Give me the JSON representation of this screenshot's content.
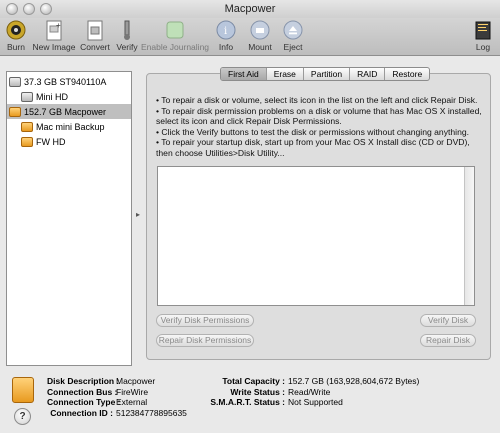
{
  "window": {
    "title": "Macpower"
  },
  "toolbar": {
    "items": [
      {
        "label": "Burn",
        "icon": "burn-icon"
      },
      {
        "label": "New Image",
        "icon": "new-image-icon"
      },
      {
        "label": "Convert",
        "icon": "convert-icon"
      },
      {
        "label": "Verify",
        "icon": "verify-icon"
      },
      {
        "label": "Enable Journaling",
        "icon": "journaling-icon"
      },
      {
        "label": "Info",
        "icon": "info-icon"
      },
      {
        "label": "Mount",
        "icon": "mount-icon"
      },
      {
        "label": "Eject",
        "icon": "eject-icon"
      },
      {
        "label": "Log",
        "icon": "log-icon"
      }
    ]
  },
  "disks": [
    {
      "label": "37.3 GB ST940110A",
      "type": "grey",
      "indent": 0,
      "selected": false
    },
    {
      "label": "Mini HD",
      "type": "grey",
      "indent": 1,
      "selected": false
    },
    {
      "label": "152.7 GB Macpower",
      "type": "orange",
      "indent": 0,
      "selected": true
    },
    {
      "label": "Mac mini Backup",
      "type": "orange",
      "indent": 1,
      "selected": false
    },
    {
      "label": "FW HD",
      "type": "orange",
      "indent": 1,
      "selected": false
    }
  ],
  "tabs": [
    "First Aid",
    "Erase",
    "Partition",
    "RAID",
    "Restore"
  ],
  "active_tab": "First Aid",
  "instructions": [
    "• To repair a disk or volume, select its icon in the list on the left and click Repair Disk.",
    "• To repair disk permission problems on a disk or volume that has Mac OS X installed, select its icon and click Repair Disk Permissions.",
    "• Click the Verify buttons to test the disk or permissions without changing anything.",
    "• To repair your startup disk, start up from your Mac OS X Install disc (CD or DVD), then choose Utilities>Disk Utility..."
  ],
  "buttons": {
    "verify_permissions": "Verify Disk Permissions",
    "repair_permissions": "Repair Disk Permissions",
    "verify_disk": "Verify Disk",
    "repair_disk": "Repair Disk"
  },
  "info": {
    "left": [
      {
        "label": "Disk Description :",
        "value": "Macpower"
      },
      {
        "label": "Connection Bus :",
        "value": "FireWire"
      },
      {
        "label": "Connection Type :",
        "value": "External"
      },
      {
        "label": "Connection ID :",
        "value": "512384778895635"
      }
    ],
    "right": [
      {
        "label": "Total Capacity :",
        "value": "152.7 GB (163,928,604,672 Bytes)"
      },
      {
        "label": "Write Status :",
        "value": "Read/Write"
      },
      {
        "label": "S.M.A.R.T. Status :",
        "value": "Not Supported"
      }
    ]
  },
  "help": {
    "glyph": "?"
  },
  "colors": {
    "selection": "#bfbfbf",
    "firewire_disk": "#e89a20"
  }
}
